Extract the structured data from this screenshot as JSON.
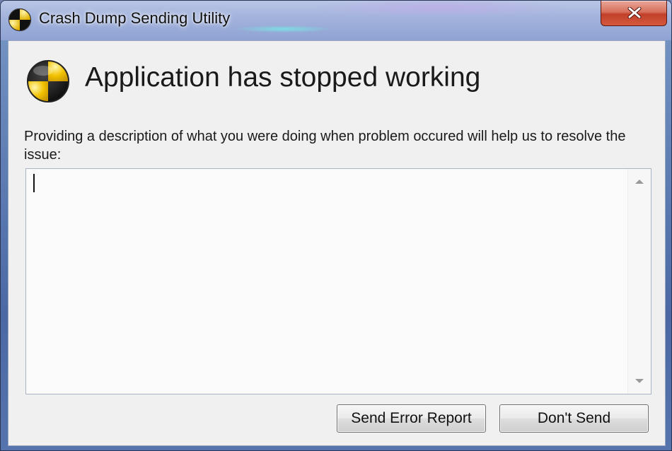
{
  "window": {
    "title": "Crash Dump Sending Utility",
    "close_glyph": "✕"
  },
  "dialog": {
    "heading": "Application has stopped working",
    "instructions": "Providing a description of what you were doing when problem occured will help us to resolve the issue:",
    "description_value": ""
  },
  "buttons": {
    "send_label": "Send Error Report",
    "dont_send_label": "Don't Send"
  },
  "icons": {
    "app_icon": "crash-warning-icon",
    "close": "close-icon",
    "scroll_up": "scroll-up-arrow-icon",
    "scroll_down": "scroll-down-arrow-icon"
  },
  "colors": {
    "icon_yellow": "#f2c200",
    "icon_black": "#111111",
    "close_red": "#c2402a"
  }
}
